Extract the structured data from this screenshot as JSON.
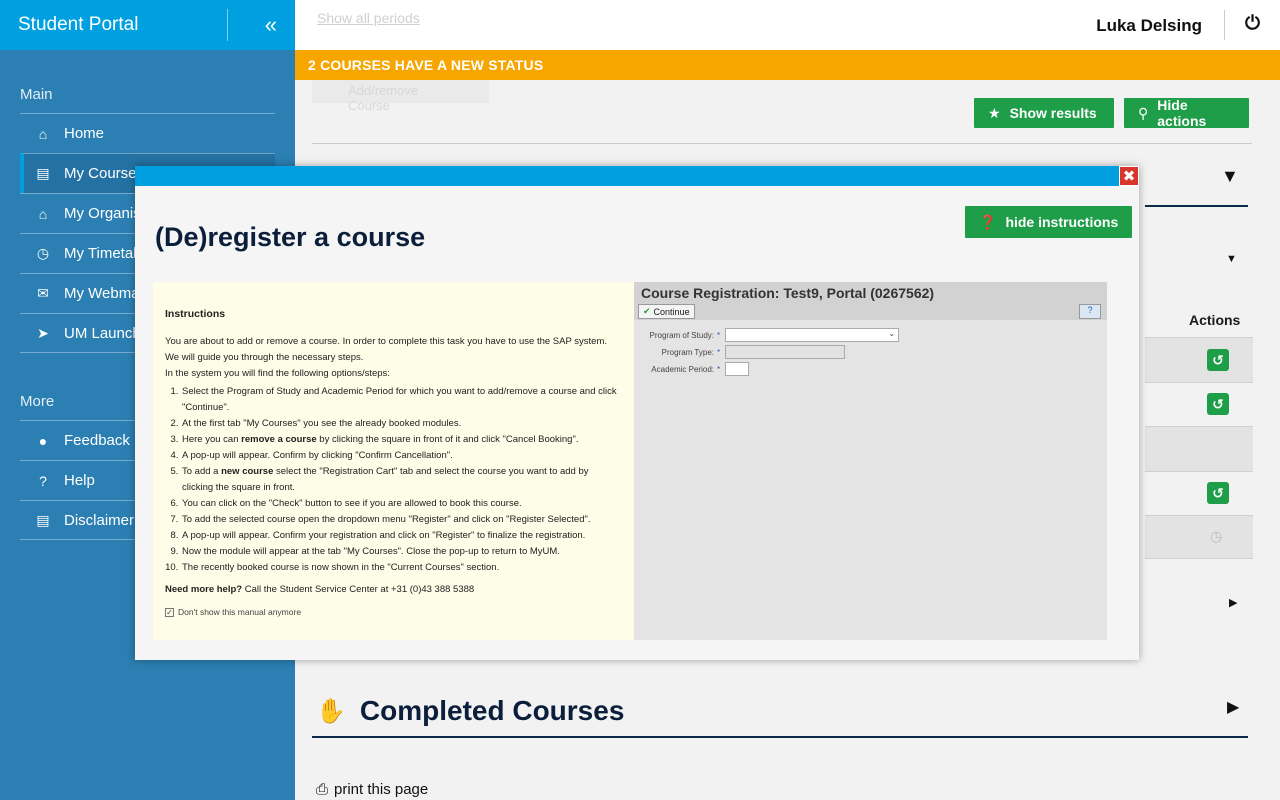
{
  "sidebar": {
    "title": "Student Portal",
    "collapse_icon": "double-chevron-left",
    "section_main": "Main",
    "section_more": "More",
    "main_items": [
      {
        "label": "Home",
        "icon": "home-icon"
      },
      {
        "label": "My Courses",
        "icon": "book-icon"
      },
      {
        "label": "My Organisation",
        "icon": "bank-icon"
      },
      {
        "label": "My Timetable",
        "icon": "clock-icon"
      },
      {
        "label": "My Webmail",
        "icon": "envelope-icon"
      },
      {
        "label": "UM Launchpad",
        "icon": "rocket-icon"
      }
    ],
    "more_items": [
      {
        "label": "Feedback",
        "icon": "microphone-icon"
      },
      {
        "label": "Help",
        "icon": "question-icon"
      },
      {
        "label": "Disclaimer",
        "icon": "document-icon"
      }
    ]
  },
  "topbar": {
    "ghost_link": "Show all periods",
    "user_name": "Luka Delsing"
  },
  "banner": {
    "text": "2 COURSES HAVE A NEW STATUS"
  },
  "main": {
    "ghost_button": "Add/remove Course",
    "show_results": "Show results",
    "hide_actions": "Hide actions",
    "actions_header": "Actions",
    "completed_title": "Completed Courses",
    "print_link": "print this page"
  },
  "modal": {
    "title": "(De)register a course",
    "hide_instructions": "hide instructions",
    "instructions": {
      "heading": "Instructions",
      "intro_1": "You are about to add or remove a course. In order to complete this task you have to use the SAP system.",
      "intro_2": "We will guide you through the necessary steps.",
      "intro_3": "In the system you will find the following options/steps:",
      "step_1": "Select the Program of Study and Academic Period for which you want to add/remove a course and click \"Continue\".",
      "step_2": "At the first tab \"My Courses\" you see the already booked modules.",
      "step_3_a": "Here you can ",
      "step_3_b": "remove a course",
      "step_3_c": " by clicking the square in front of it and click \"Cancel Booking\".",
      "step_4": "A pop-up will appear. Confirm by clicking \"Confirm Cancellation\".",
      "step_5_a": "To add a ",
      "step_5_b": "new course",
      "step_5_c": " select the \"Registration Cart\" tab and select the course you want to add by clicking the square in front.",
      "step_6": "You can click on the \"Check\" button to see if you are allowed to book this course.",
      "step_7": "To add the selected course open the dropdown menu \"Register\" and click on \"Register Selected\".",
      "step_8": "A pop-up will appear. Confirm your registration and click on \"Register\" to finalize the registration.",
      "step_9": "Now the module will appear at the tab \"My Courses\". Close the pop-up to return to MyUM.",
      "step_10": "The recently booked course is now shown in the \"Current Courses\" section.",
      "help_bold": "Need more help?",
      "help_text": " Call the Student Service Center at +31 (0)43 388 5388",
      "dont_show": "Don't show this manual anymore"
    },
    "sap": {
      "title": "Course Registration: Test9, Portal (0267562)",
      "continue": "Continue",
      "help_icon": "?",
      "program_of_study": "Program of Study:",
      "program_type": "Program Type:",
      "academic_period": "Academic Period:",
      "required_mark": "*"
    }
  },
  "colors": {
    "sidebar": "#2c7fb2",
    "header_accent": "#00a0e0",
    "banner": "#f7a600",
    "button_green": "#1e9e48",
    "heading_navy": "#0b1e3a",
    "close_red": "#d7372a"
  }
}
